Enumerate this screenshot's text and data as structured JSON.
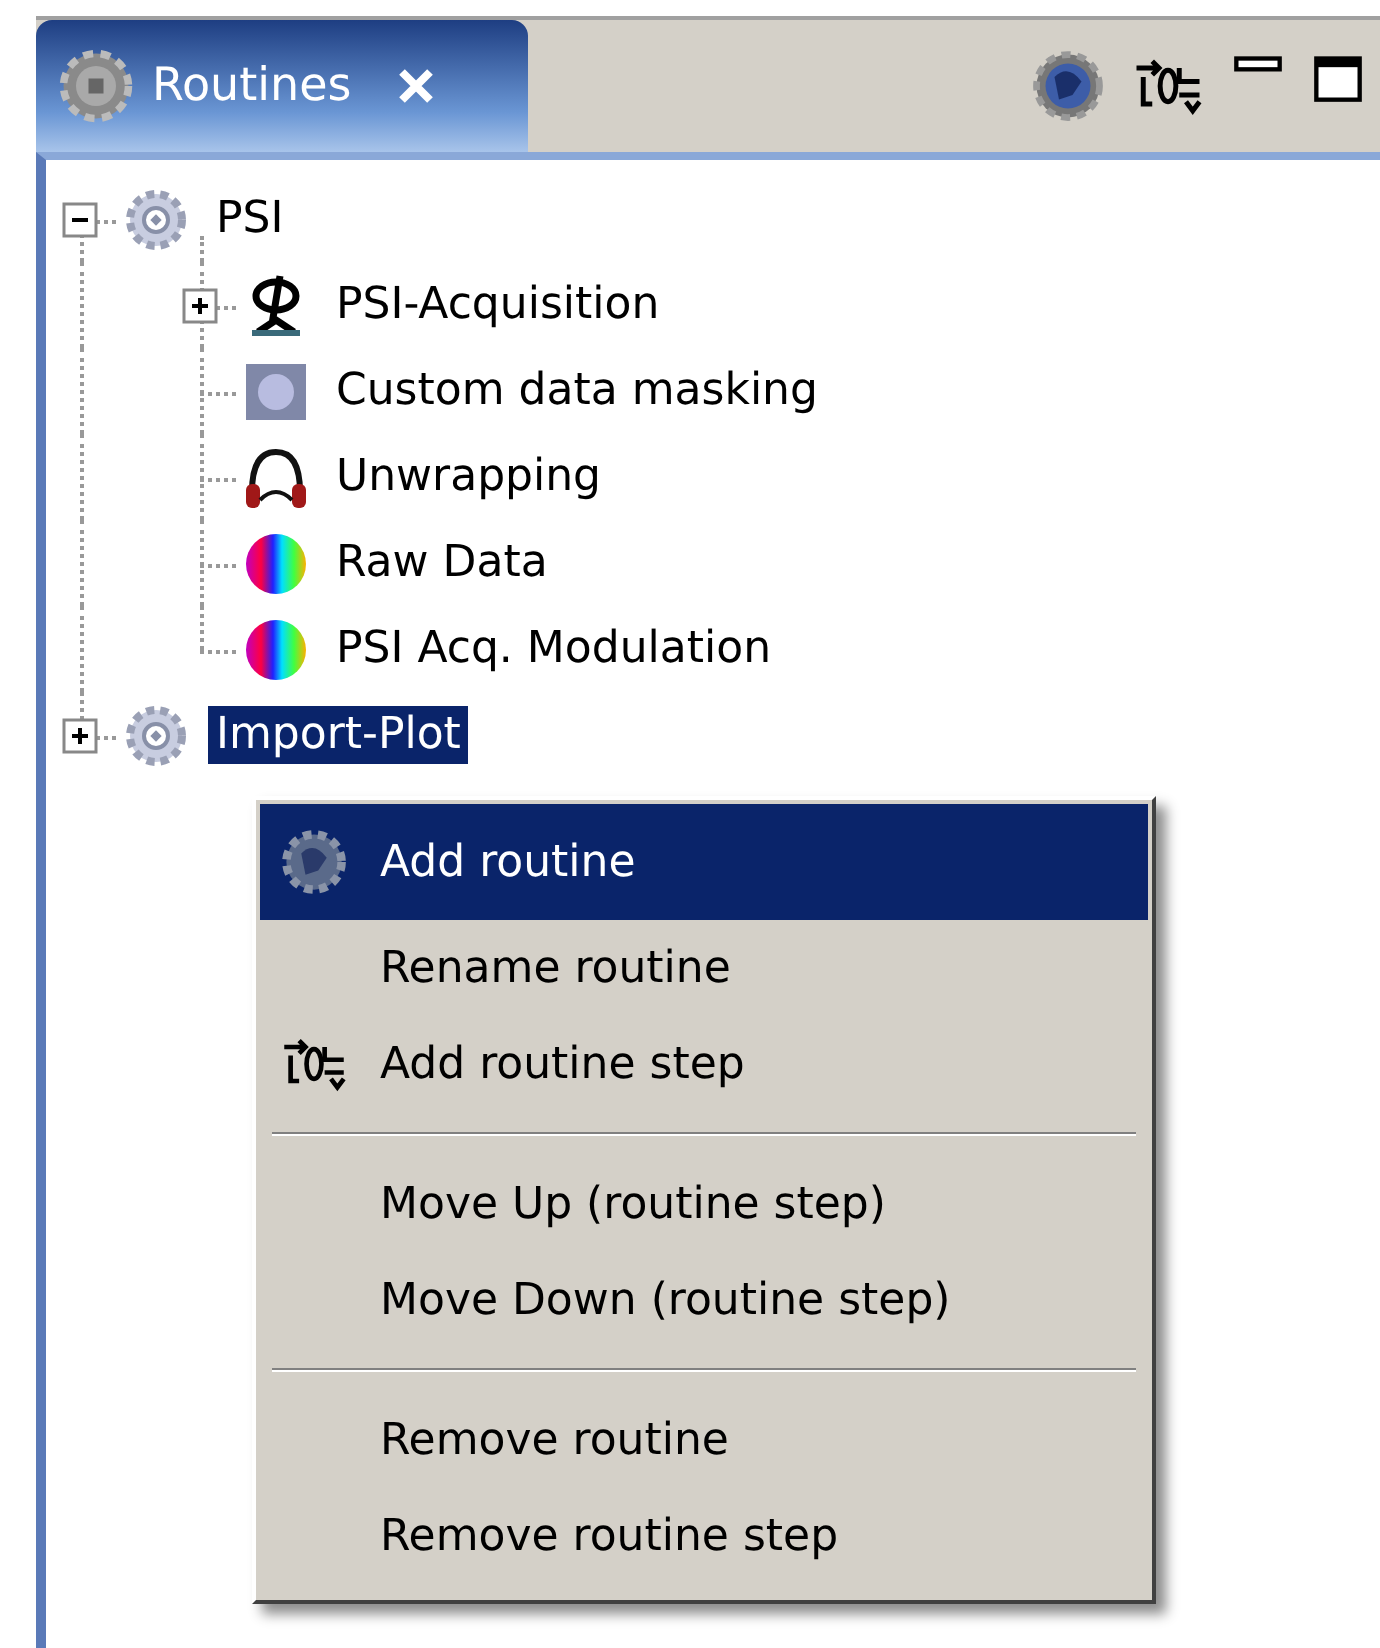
{
  "view_tab": {
    "label": "Routines",
    "selected": true
  },
  "tree": [
    {
      "label": "PSI",
      "kind": "gear",
      "expanded": true,
      "selected": false,
      "children": [
        {
          "label": "PSI-Acquisition",
          "kind": "phi",
          "expanded": false,
          "selected": false
        },
        {
          "label": "Custom data masking",
          "kind": "mask",
          "selected": false
        },
        {
          "label": "Unwrapping",
          "kind": "headphones",
          "selected": false
        },
        {
          "label": "Raw Data",
          "kind": "rainbow",
          "selected": false
        },
        {
          "label": "PSI Acq. Modulation",
          "kind": "rainbow",
          "selected": false
        }
      ]
    },
    {
      "label": "Import-Plot",
      "kind": "gear",
      "expanded": false,
      "selected": true
    }
  ],
  "context_menu": {
    "sections": [
      [
        {
          "label": "Add routine",
          "kind": "globe-gear",
          "selected": true
        },
        {
          "label": "Rename routine",
          "kind": "plain",
          "selected": false
        },
        {
          "label": "Add routine step",
          "kind": "step",
          "selected": false
        }
      ],
      [
        {
          "label": "Move Up (routine step)",
          "kind": "plain",
          "selected": false
        },
        {
          "label": "Move Down (routine step)",
          "kind": "plain",
          "selected": false
        }
      ],
      [
        {
          "label": "Remove routine",
          "kind": "plain",
          "selected": false
        },
        {
          "label": "Remove routine step",
          "kind": "plain",
          "selected": false
        }
      ]
    ]
  }
}
